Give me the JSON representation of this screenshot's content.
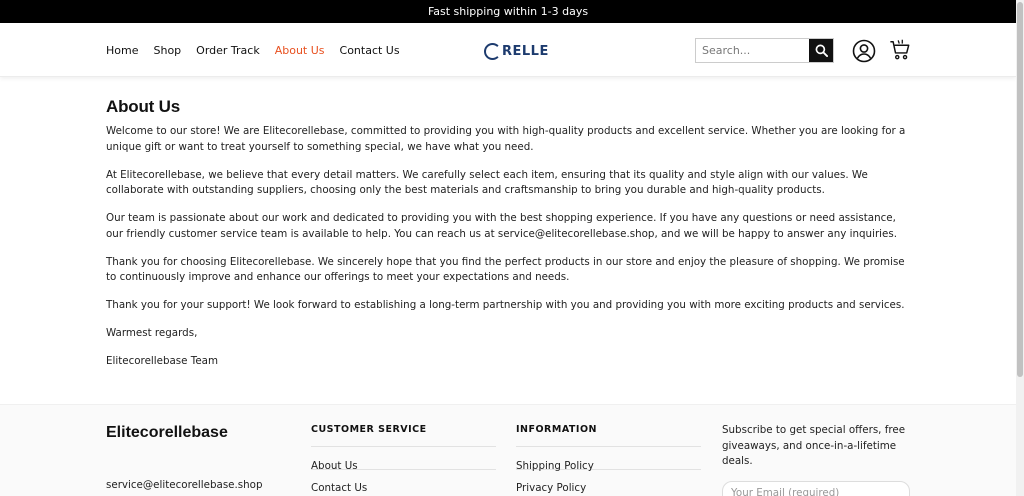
{
  "announcement": "Fast shipping within 1-3 days",
  "nav": {
    "items": [
      {
        "label": "Home",
        "active": false
      },
      {
        "label": "Shop",
        "active": false
      },
      {
        "label": "Order Track",
        "active": false
      },
      {
        "label": "About Us",
        "active": true
      },
      {
        "label": "Contact Us",
        "active": false
      }
    ]
  },
  "logo": {
    "text": "RELLE"
  },
  "search": {
    "placeholder": "Search..."
  },
  "icons": {
    "search": "search-icon",
    "account": "user-icon",
    "cart": "cart-icon"
  },
  "colors": {
    "accent": "#e8501f",
    "logo": "#1d3b6e",
    "announce_bg": "#000000"
  },
  "content": {
    "title": "About Us",
    "paragraphs": [
      "Welcome to our store! We are Elitecorellebase, committed to providing you with high-quality products and excellent service. Whether you are looking for a unique gift or want to treat yourself to something special, we have what you need.",
      "At Elitecorellebase, we believe that every detail matters. We carefully select each item, ensuring that its quality and style align with our values. We collaborate with outstanding suppliers, choosing only the best materials and craftsmanship to bring you durable and high-quality products.",
      "Our team is passionate about our work and dedicated to providing you with the best shopping experience. If you have any questions or need assistance, our friendly customer service team is available to help. You can reach us at service@elitecorellebase.shop, and we will be happy to answer any inquiries.",
      "Thank you for choosing Elitecorellebase. We sincerely hope that you find the perfect products in our store and enjoy the pleasure of shopping. We promise to continuously improve and enhance our offerings to meet your expectations and needs.",
      "Thank you for your support! We look forward to establishing a long-term partnership with you and providing you with more exciting products and services.",
      "Warmest regards,",
      "Elitecorellebase Team"
    ]
  },
  "footer": {
    "brand": "Elitecorellebase",
    "email": "service@elitecorellebase.shop",
    "customer_service": {
      "heading": "CUSTOMER SERVICE",
      "links": [
        "About Us",
        "Contact Us"
      ]
    },
    "information": {
      "heading": "INFORMATION",
      "links": [
        "Shipping Policy",
        "Privacy Policy"
      ]
    },
    "subscribe_text": "Subscribe to get special offers, free giveaways, and once-in-a-lifetime deals.",
    "email_placeholder": "Your Email (required)"
  }
}
